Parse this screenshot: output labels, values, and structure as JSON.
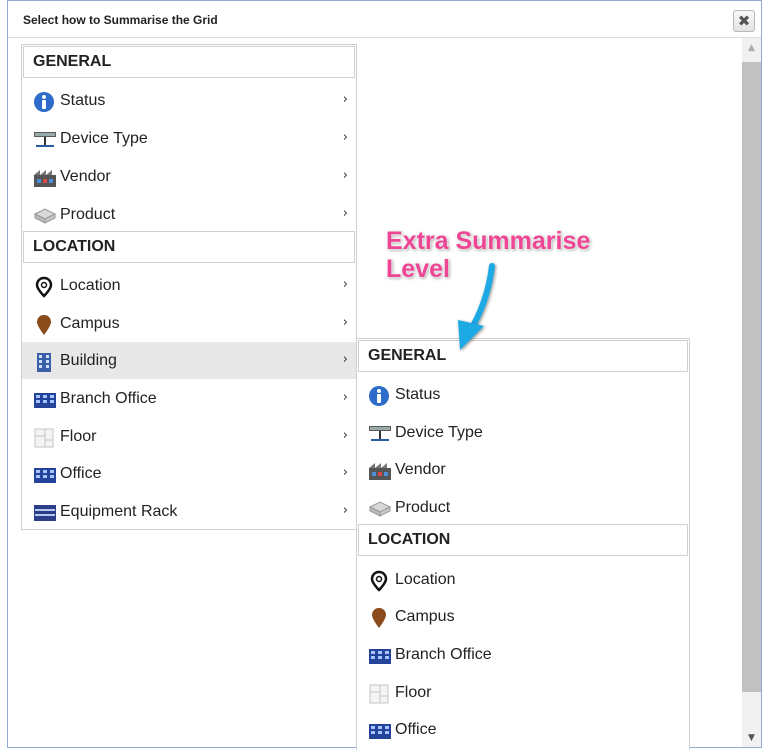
{
  "dialog": {
    "title": "Select how to Summarise the Grid",
    "close_glyph": "✖"
  },
  "scrollbar": {
    "up_glyph": "▲",
    "down_glyph": "▼"
  },
  "colors": {
    "accent_pink": "#ee4594",
    "arrow_blue": "#1ea9e4",
    "active_row": "#e8e8e8",
    "border": "#8faad3"
  },
  "menu_l1": {
    "general_header": "GENERAL",
    "general_items": [
      {
        "label": "Status",
        "icon": "info-icon"
      },
      {
        "label": "Device Type",
        "icon": "device-type-icon"
      },
      {
        "label": "Vendor",
        "icon": "vendor-icon"
      },
      {
        "label": "Product",
        "icon": "product-icon"
      }
    ],
    "location_header": "LOCATION",
    "location_items": [
      {
        "label": "Location",
        "icon": "location-pin-icon"
      },
      {
        "label": "Campus",
        "icon": "campus-pin-icon"
      },
      {
        "label": "Building",
        "icon": "building-icon"
      },
      {
        "label": "Branch Office",
        "icon": "branch-office-icon"
      },
      {
        "label": "Floor",
        "icon": "floor-icon"
      },
      {
        "label": "Office",
        "icon": "office-icon"
      },
      {
        "label": "Equipment Rack",
        "icon": "equipment-rack-icon"
      }
    ],
    "chevron": "›"
  },
  "menu_l2": {
    "general_header": "GENERAL",
    "general_items": [
      {
        "label": "Status",
        "icon": "info-icon"
      },
      {
        "label": "Device Type",
        "icon": "device-type-icon"
      },
      {
        "label": "Vendor",
        "icon": "vendor-icon"
      },
      {
        "label": "Product",
        "icon": "product-icon"
      }
    ],
    "location_header": "LOCATION",
    "location_items": [
      {
        "label": "Location",
        "icon": "location-pin-icon"
      },
      {
        "label": "Campus",
        "icon": "campus-pin-icon"
      },
      {
        "label": "Branch Office",
        "icon": "branch-office-icon"
      },
      {
        "label": "Floor",
        "icon": "floor-icon"
      },
      {
        "label": "Office",
        "icon": "office-icon"
      }
    ]
  },
  "annotation": {
    "line1": "Extra Summarise",
    "line2": "Level"
  }
}
